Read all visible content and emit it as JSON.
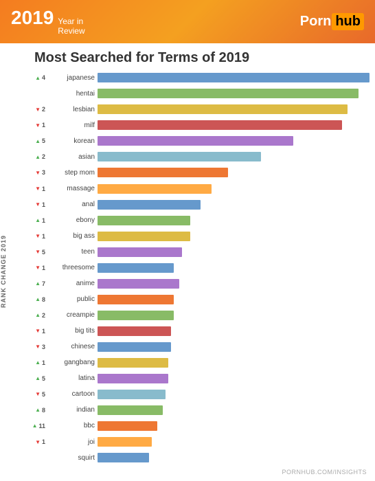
{
  "header": {
    "year": "2019",
    "subtitle_line1": "Year in",
    "subtitle_line2": "Review",
    "logo_part1": "Porn",
    "logo_part2": "hub"
  },
  "title": "Most Searched for Terms of 2019",
  "y_axis_label": "RANK CHANGE 2019",
  "footer": "PORNHUB.COM/INSIGHTS",
  "bars": [
    {
      "label": "japanese",
      "direction": "up",
      "amount": 4,
      "color": "#6699cc",
      "pct": 100
    },
    {
      "label": "hentai",
      "direction": "none",
      "amount": 0,
      "color": "#88bb66",
      "pct": 96
    },
    {
      "label": "lesbian",
      "direction": "down",
      "amount": 2,
      "color": "#ddbb44",
      "pct": 92
    },
    {
      "label": "milf",
      "direction": "down",
      "amount": 1,
      "color": "#cc5555",
      "pct": 90
    },
    {
      "label": "korean",
      "direction": "up",
      "amount": 5,
      "color": "#aa77cc",
      "pct": 72
    },
    {
      "label": "asian",
      "direction": "up",
      "amount": 2,
      "color": "#88bbcc",
      "pct": 60
    },
    {
      "label": "step mom",
      "direction": "down",
      "amount": 3,
      "color": "#ee7733",
      "pct": 48
    },
    {
      "label": "massage",
      "direction": "down",
      "amount": 1,
      "color": "#ffaa44",
      "pct": 42
    },
    {
      "label": "anal",
      "direction": "down",
      "amount": 1,
      "color": "#6699cc",
      "pct": 38
    },
    {
      "label": "ebony",
      "direction": "up",
      "amount": 1,
      "color": "#88bb66",
      "pct": 34
    },
    {
      "label": "big ass",
      "direction": "down",
      "amount": 1,
      "color": "#ddbb44",
      "pct": 34
    },
    {
      "label": "teen",
      "direction": "down",
      "amount": 5,
      "color": "#aa77cc",
      "pct": 31
    },
    {
      "label": "threesome",
      "direction": "down",
      "amount": 1,
      "color": "#6699cc",
      "pct": 28
    },
    {
      "label": "anime",
      "direction": "up",
      "amount": 7,
      "color": "#aa77cc",
      "pct": 30
    },
    {
      "label": "public",
      "direction": "up",
      "amount": 8,
      "color": "#ee7733",
      "pct": 28
    },
    {
      "label": "creampie",
      "direction": "up",
      "amount": 2,
      "color": "#88bb66",
      "pct": 28
    },
    {
      "label": "big tits",
      "direction": "down",
      "amount": 1,
      "color": "#cc5555",
      "pct": 27
    },
    {
      "label": "chinese",
      "direction": "down",
      "amount": 3,
      "color": "#6699cc",
      "pct": 27
    },
    {
      "label": "gangbang",
      "direction": "up",
      "amount": 1,
      "color": "#ddbb44",
      "pct": 26
    },
    {
      "label": "latina",
      "direction": "up",
      "amount": 5,
      "color": "#aa77cc",
      "pct": 26
    },
    {
      "label": "cartoon",
      "direction": "down",
      "amount": 5,
      "color": "#88bbcc",
      "pct": 25
    },
    {
      "label": "indian",
      "direction": "up",
      "amount": 8,
      "color": "#88bb66",
      "pct": 24
    },
    {
      "label": "bbc",
      "direction": "up",
      "amount": 11,
      "color": "#ee7733",
      "pct": 22
    },
    {
      "label": "joi",
      "direction": "down",
      "amount": 1,
      "color": "#ffaa44",
      "pct": 20
    },
    {
      "label": "squirt",
      "direction": "none",
      "amount": 0,
      "color": "#6699cc",
      "pct": 19
    }
  ]
}
